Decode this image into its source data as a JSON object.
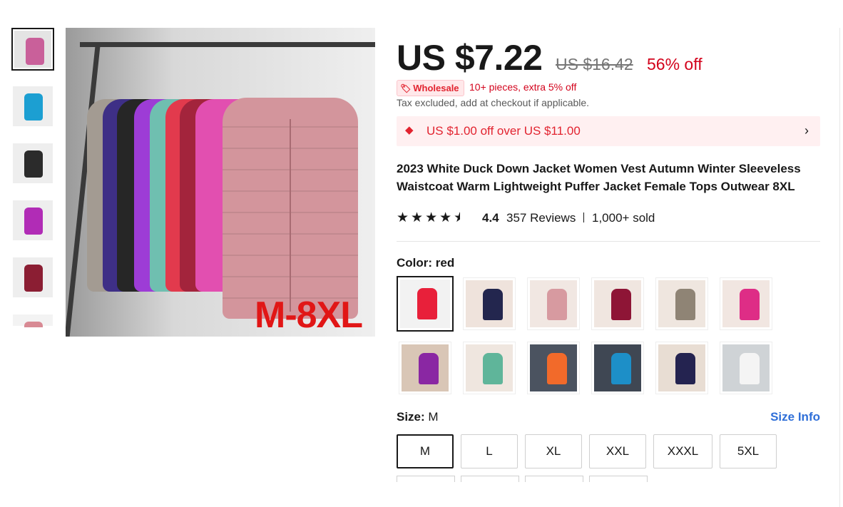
{
  "gallery": {
    "badge": "M-8XL",
    "thumbs": [
      {
        "name": "thumb-multicolor",
        "color": "#c9609a",
        "bg": "#e4e4e4"
      },
      {
        "name": "thumb-blue",
        "color": "#1c9fd2",
        "bg": "#eeeeee"
      },
      {
        "name": "thumb-black",
        "color": "#2b2b2b",
        "bg": "#eeeeee"
      },
      {
        "name": "thumb-magenta",
        "color": "#b12cb6",
        "bg": "#eeeeee"
      },
      {
        "name": "thumb-burgundy",
        "color": "#8b1e33",
        "bg": "#eeeeee"
      },
      {
        "name": "thumb-row",
        "color": "#d88a94",
        "bg": "#f3f3f3"
      }
    ]
  },
  "price": {
    "current": "US $7.22",
    "original": "US $16.42",
    "discount": "56% off"
  },
  "wholesale": {
    "badge": "Wholesale",
    "text": "10+ pieces, extra 5% off"
  },
  "tax_note": "Tax excluded, add at checkout if applicable.",
  "coupon": {
    "text": "US $1.00 off over US $11.00",
    "chevron": "›"
  },
  "product": {
    "title": "2023 White Duck Down Jacket Women Vest Autumn Winter Sleeveless Waistcoat Warm Lightweight Puffer Jacket Female Tops Outwear 8XL"
  },
  "rating": {
    "stars": 4.4,
    "score": "4.4",
    "reviews": "357 Reviews",
    "sold": "1,000+ sold"
  },
  "color": {
    "label": "Color:",
    "selected": "red",
    "options": [
      {
        "name": "red",
        "color": "#e8203a",
        "bg": "#f2f2f2"
      },
      {
        "name": "navy",
        "color": "#23264e",
        "bg": "#efe3dc"
      },
      {
        "name": "pink",
        "color": "#d79aa0",
        "bg": "#f1e7e2"
      },
      {
        "name": "burgundy",
        "color": "#8e1536",
        "bg": "#f0e6e0"
      },
      {
        "name": "khaki",
        "color": "#8f8475",
        "bg": "#efe6df"
      },
      {
        "name": "rose",
        "color": "#de2d86",
        "bg": "#f1e6e1"
      },
      {
        "name": "purple",
        "color": "#8a27a3",
        "bg": "#d9c6b6"
      },
      {
        "name": "mint",
        "color": "#5fb59a",
        "bg": "#efe6df"
      },
      {
        "name": "orange",
        "color": "#f26a2a",
        "bg": "#4b5360"
      },
      {
        "name": "blue",
        "color": "#1d8fc8",
        "bg": "#3f4753"
      },
      {
        "name": "dark-navy",
        "color": "#242350",
        "bg": "#e8ddd3"
      },
      {
        "name": "white",
        "color": "#f4f4f4",
        "bg": "#cfd3d6"
      }
    ]
  },
  "size": {
    "label": "Size:",
    "selected": "M",
    "info_link": "Size Info",
    "options": [
      "M",
      "L",
      "XL",
      "XXL",
      "XXXL",
      "5XL"
    ]
  }
}
